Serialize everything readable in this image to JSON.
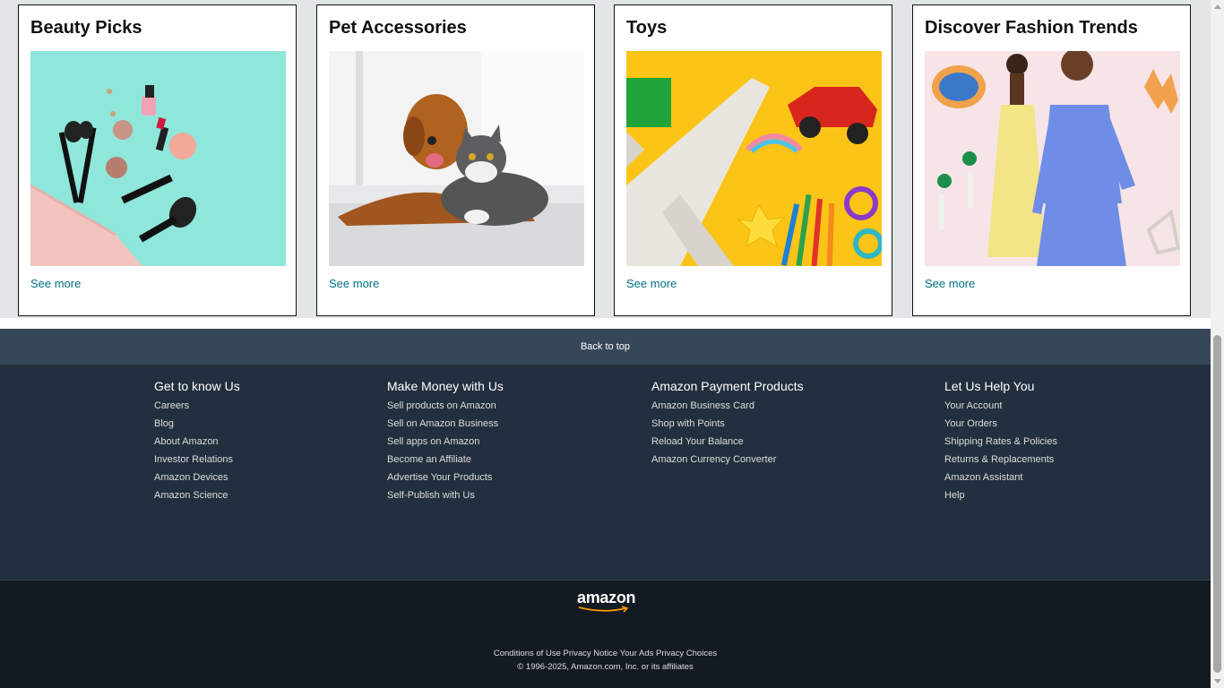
{
  "cards": [
    {
      "title": "Beauty Picks",
      "link": "See more"
    },
    {
      "title": "Pet Accessories",
      "link": "See more"
    },
    {
      "title": "Toys",
      "link": "See more"
    },
    {
      "title": "Discover Fashion Trends",
      "link": "See more"
    }
  ],
  "back_to_top": "Back to top",
  "footer": {
    "columns": [
      {
        "heading": "Get to know Us",
        "links": [
          "Careers",
          "Blog",
          "About Amazon",
          "Investor Relations",
          "Amazon Devices",
          "Amazon Science"
        ]
      },
      {
        "heading": "Make Money with Us",
        "links": [
          "Sell products on Amazon",
          "Sell on Amazon Business",
          "Sell apps on Amazon",
          "Become an Affiliate",
          "Advertise Your Products",
          "Self-Publish with Us"
        ]
      },
      {
        "heading": "Amazon Payment Products",
        "links": [
          "Amazon Business Card",
          "Shop with Points",
          "Reload Your Balance",
          "Amazon Currency Converter"
        ]
      },
      {
        "heading": "Let Us Help You",
        "links": [
          "Your Account",
          "Your Orders",
          "Shipping Rates & Policies",
          "Returns & Replacements",
          "Amazon Assistant",
          "Help"
        ]
      }
    ],
    "logo": "amazon",
    "legal_links": [
      "Conditions of Use",
      "Privacy Notice",
      "Your Ads Privacy Choices"
    ],
    "copyright": "© 1996-2025, Amazon.com, Inc. or its affiliates"
  },
  "colors": {
    "link": "#007185",
    "back_to_top_bg": "#37475a",
    "footer_bg": "#232f3e",
    "bottom_bg": "#131a22",
    "logo_smile": "#ff9900"
  },
  "icons": {
    "logo_smile": "smile-arrow-icon",
    "scroll_up": "chevron-up-icon",
    "scroll_down": "chevron-down-icon"
  }
}
